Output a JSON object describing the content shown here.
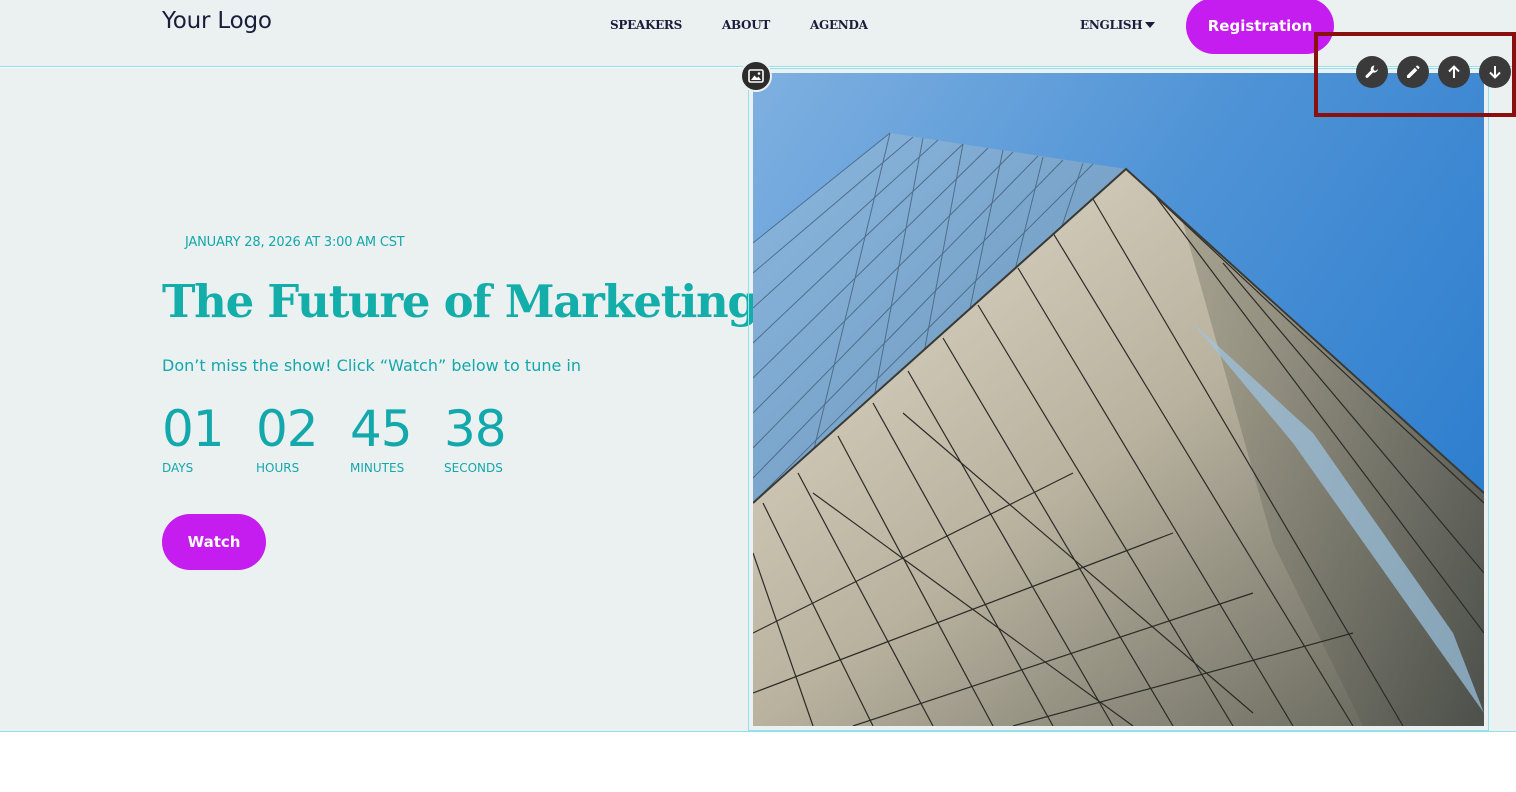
{
  "header": {
    "logo": "Your Logo",
    "nav": [
      "SPEAKERS",
      "ABOUT",
      "AGENDA"
    ],
    "language": "ENGLISH",
    "register_label": "Registration"
  },
  "hero": {
    "date_line": "JANUARY 28, 2026 AT 3:00 AM CST",
    "title": "The Future of Marketing",
    "subtitle": "Don’t miss the show! Click “Watch” below to tune in",
    "countdown": [
      {
        "value": "01",
        "label": "DAYS"
      },
      {
        "value": "02",
        "label": "HOURS"
      },
      {
        "value": "45",
        "label": "MINUTES"
      },
      {
        "value": "38",
        "label": "SECONDS"
      }
    ],
    "watch_label": "Watch"
  },
  "toolbar": {
    "icons": [
      "wrench-icon",
      "pencil-icon",
      "arrow-up-icon",
      "arrow-down-icon"
    ]
  },
  "colors": {
    "accent": "#c51cf0",
    "teal": "#13adaa",
    "background": "#ebf0f0",
    "navy": "#1a1d3b"
  }
}
